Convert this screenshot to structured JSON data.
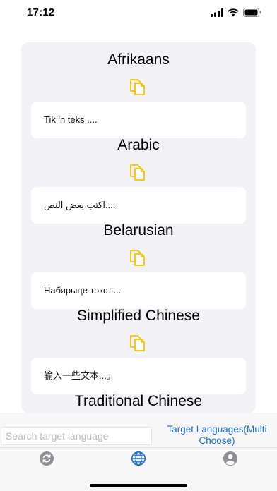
{
  "status": {
    "time": "17:12"
  },
  "languages": [
    {
      "name": "Afrikaans",
      "text": "Tik 'n teks ...."
    },
    {
      "name": "Arabic",
      "text": "اكتب بعض النص...."
    },
    {
      "name": "Belarusian",
      "text": "Набярыце тэкст...."
    },
    {
      "name": "Simplified Chinese",
      "text": "输入一些文本...。"
    },
    {
      "name": "Traditional Chinese",
      "text": ""
    }
  ],
  "search": {
    "placeholder": "Search target language",
    "value": ""
  },
  "target_button": {
    "label": "Target Languages(Multi Choose)"
  },
  "tabs": [
    {
      "icon": "refresh-icon",
      "selected": false
    },
    {
      "icon": "globe-icon",
      "selected": true
    },
    {
      "icon": "profile-icon",
      "selected": false
    }
  ],
  "colors": {
    "accent": "#1a6fe0",
    "copy_icon": "#f5c400",
    "card_bg": "#f2f2f6",
    "tab_inactive": "#8e8e93"
  }
}
